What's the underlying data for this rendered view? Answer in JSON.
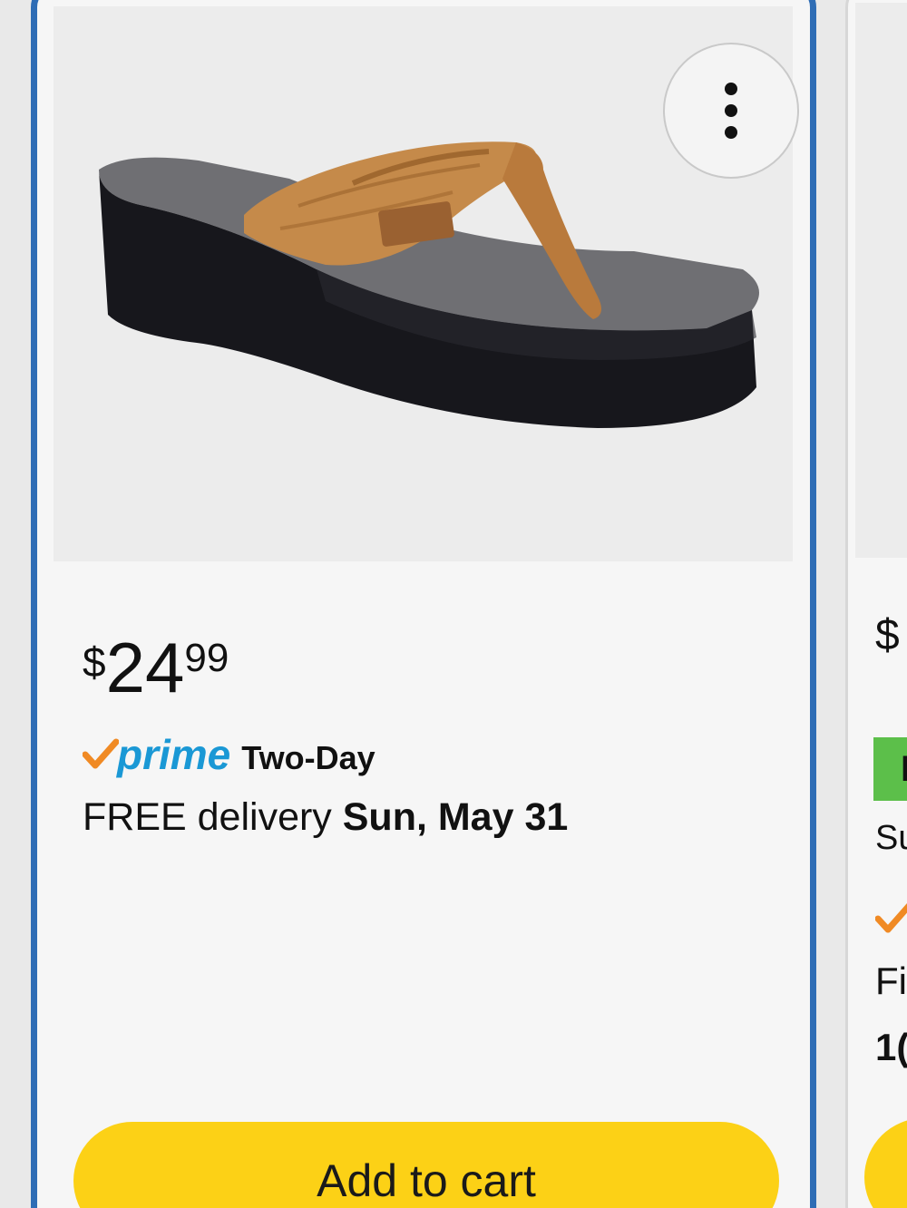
{
  "product": {
    "price": {
      "currency": "$",
      "whole": "24",
      "cents": "99"
    },
    "shipping": {
      "prime_label": "prime",
      "speed_label": "Two-Day",
      "delivery_prefix": "FREE delivery",
      "delivery_date": "Sun, May 31"
    },
    "add_to_cart_label": "Add to cart",
    "more_options_icon": "more-vertical-icon"
  },
  "next_product": {
    "price_partial": "$",
    "badge_partial": "I",
    "line1_partial": "Su",
    "line2_partial": "Fi",
    "line3_partial": "1("
  },
  "colors": {
    "card_border": "#2f6db5",
    "button_yellow": "#fcd116",
    "prime_blue": "#1a98d5",
    "prime_check_orange": "#f08a24",
    "badge_green": "#5cbf4a"
  }
}
